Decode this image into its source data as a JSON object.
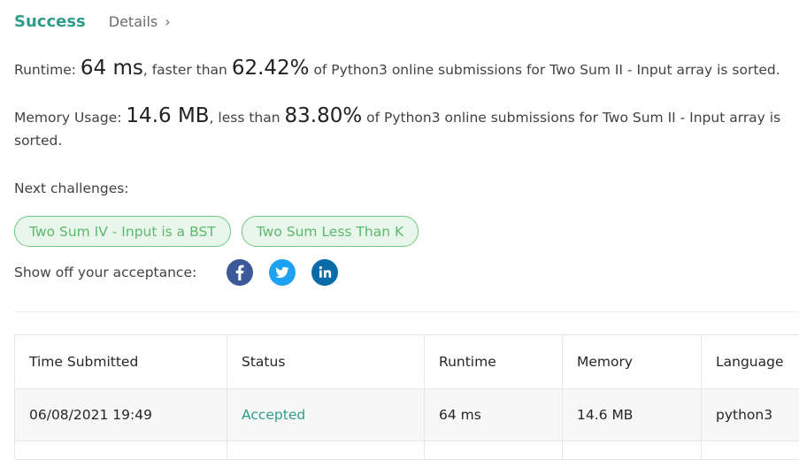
{
  "header": {
    "status_label": "Success",
    "details_label": "Details",
    "details_chevron": "›"
  },
  "runtime": {
    "prefix": "Runtime: ",
    "value": "64 ms",
    "middle": ", faster than ",
    "percent": "62.42%",
    "suffix": " of Python3 online submissions for Two Sum II - Input array is sorted."
  },
  "memory": {
    "prefix": "Memory Usage: ",
    "value": "14.6 MB",
    "middle": ", less than ",
    "percent": "83.80%",
    "suffix": " of Python3 online submissions for Two Sum II - Input array is sorted."
  },
  "next_challenges": {
    "label": "Next challenges:",
    "items": [
      "Two Sum IV - Input is a BST",
      "Two Sum Less Than K"
    ]
  },
  "share": {
    "label": "Show off your acceptance:",
    "icons": [
      "facebook-icon",
      "twitter-icon",
      "linkedin-icon"
    ],
    "colors": {
      "facebook": "#3b5998",
      "twitter": "#1da1f2",
      "linkedin": "#0b6aa8"
    }
  },
  "table": {
    "headers": [
      "Time Submitted",
      "Status",
      "Runtime",
      "Memory",
      "Language"
    ],
    "rows": [
      [
        "06/08/2021 19:49",
        "Accepted",
        "64 ms",
        "14.6 MB",
        "python3"
      ]
    ]
  },
  "colors": {
    "success": "#2f9c8b",
    "chip_border": "#73c781",
    "chip_text": "#5cb96d"
  }
}
